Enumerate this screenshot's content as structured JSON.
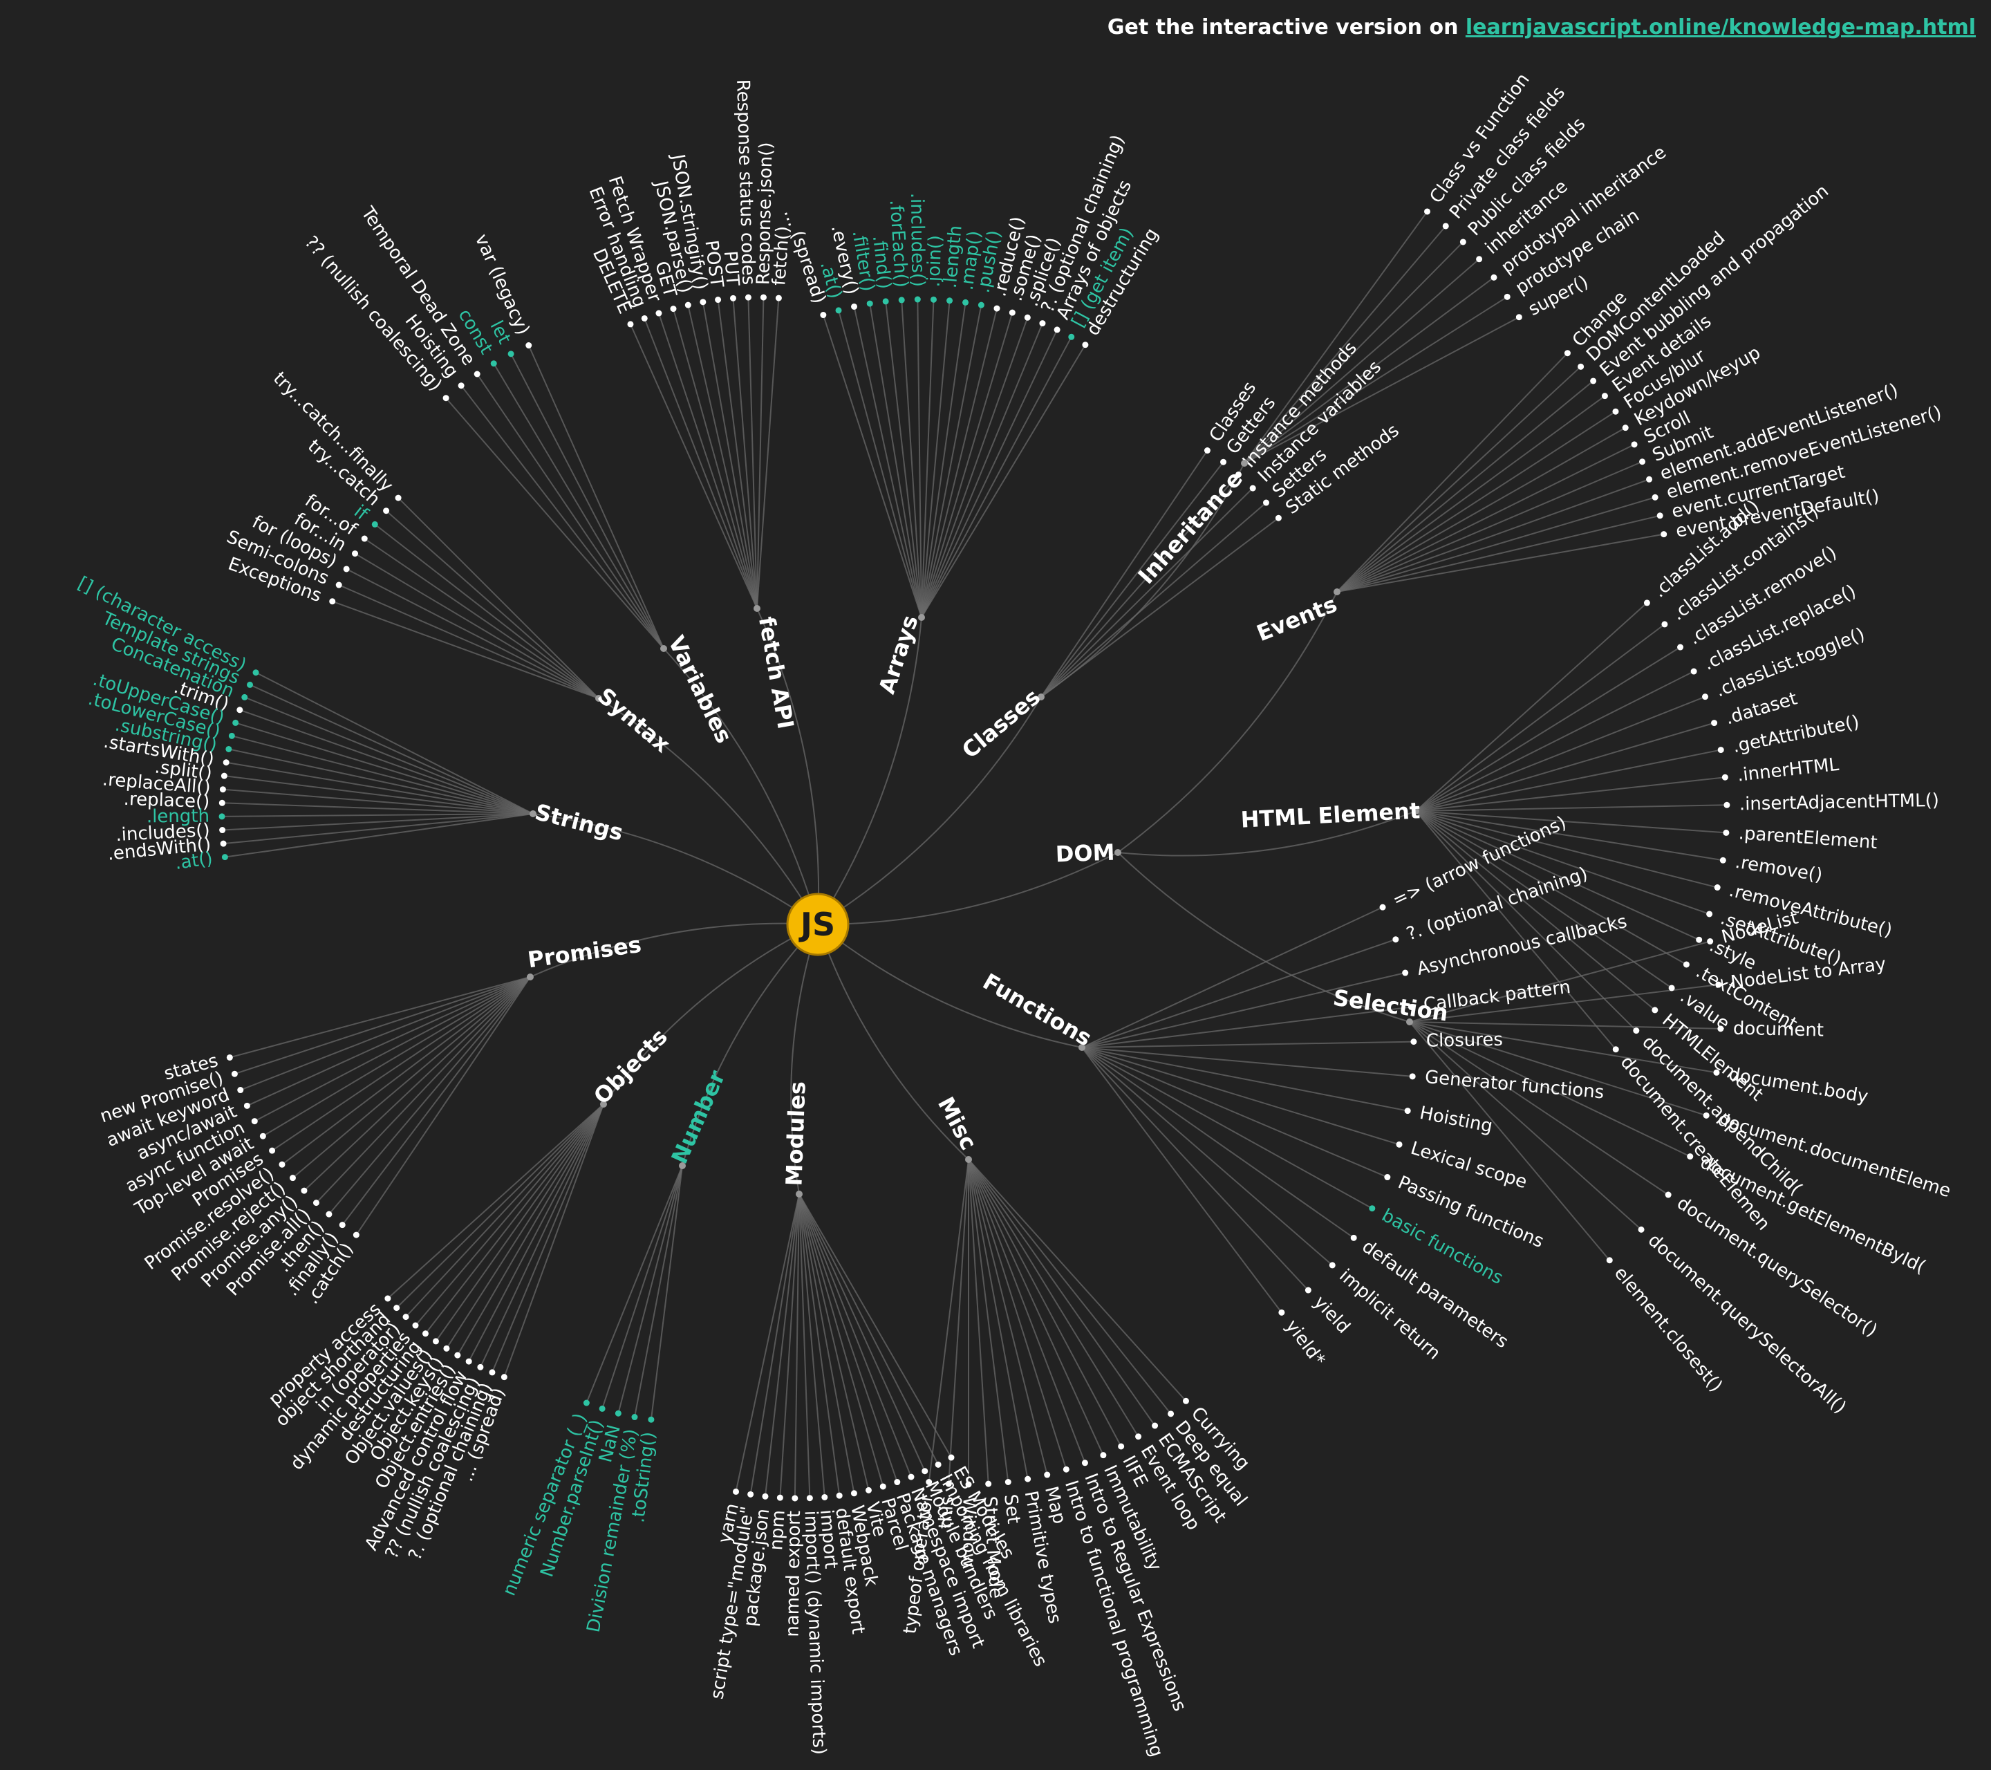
{
  "header": {
    "prefix": "Get the interactive version on ",
    "link_text": "learnjavascript.online/knowledge-map.html"
  },
  "colors": {
    "background": "#222222",
    "text": "#ffffff",
    "accent": "#2ec4a4",
    "root": "#f5b800",
    "edge": "#6a6a6a"
  },
  "root": {
    "label": "JS"
  },
  "groups": [
    {
      "id": "fetch",
      "label": "fetch API",
      "leaves": [
        {
          "t": "fetch()"
        },
        {
          "t": "Response.json()"
        },
        {
          "t": "Response status codes"
        },
        {
          "t": "PUT"
        },
        {
          "t": "POST"
        },
        {
          "t": "JSON.stringify()"
        },
        {
          "t": "JSON.parse()"
        },
        {
          "t": "GET"
        },
        {
          "t": "Fetch Wrapper"
        },
        {
          "t": "Error handling"
        },
        {
          "t": "DELETE"
        }
      ]
    },
    {
      "id": "arrays",
      "label": "Arrays",
      "leaves": [
        {
          "t": "... (spread)"
        },
        {
          "t": ".at()",
          "hl": true
        },
        {
          "t": ".every()"
        },
        {
          "t": ".filter()",
          "hl": true
        },
        {
          "t": ".find()",
          "hl": true
        },
        {
          "t": ".forEach()",
          "hl": true
        },
        {
          "t": ".includes()",
          "hl": true
        },
        {
          "t": ".join()",
          "hl": true
        },
        {
          "t": ".length",
          "hl": true
        },
        {
          "t": ".map()",
          "hl": true
        },
        {
          "t": ".push()",
          "hl": true
        },
        {
          "t": ".reduce()"
        },
        {
          "t": ".some()"
        },
        {
          "t": ".splice()"
        },
        {
          "t": "?. (optional chaining)"
        },
        {
          "t": "Arrays of objects"
        },
        {
          "t": "[] (get item)",
          "hl": true
        },
        {
          "t": "destructuring"
        }
      ]
    },
    {
      "id": "variables",
      "label": "Variables",
      "leaves": [
        {
          "t": "var (legacy)"
        },
        {
          "t": "let",
          "hl": true
        },
        {
          "t": "const",
          "hl": true
        },
        {
          "t": "Temporal Dead Zone"
        },
        {
          "t": "Hoisting"
        },
        {
          "t": "?? (nullish coalescing)"
        }
      ]
    },
    {
      "id": "syntax",
      "label": "Syntax",
      "leaves": [
        {
          "t": "try...catch...finally"
        },
        {
          "t": "try...catch"
        },
        {
          "t": "if",
          "hl": true
        },
        {
          "t": "for...of"
        },
        {
          "t": "for...in"
        },
        {
          "t": "for (loops)"
        },
        {
          "t": "Semi-colons"
        },
        {
          "t": "Exceptions"
        }
      ]
    },
    {
      "id": "strings",
      "label": "Strings",
      "leaves": [
        {
          "t": "[] (character access)",
          "hl": true
        },
        {
          "t": "Template strings",
          "hl": true
        },
        {
          "t": "Concatenation",
          "hl": true
        },
        {
          "t": ".trim()"
        },
        {
          "t": ".toUpperCase()",
          "hl": true
        },
        {
          "t": ".toLowerCase()",
          "hl": true
        },
        {
          "t": ".substring()",
          "hl": true
        },
        {
          "t": ".startsWith()"
        },
        {
          "t": ".split()"
        },
        {
          "t": ".replaceAll()"
        },
        {
          "t": ".replace()"
        },
        {
          "t": ".length",
          "hl": true
        },
        {
          "t": ".includes()"
        },
        {
          "t": ".endsWith()"
        },
        {
          "t": ".at()",
          "hl": true
        }
      ]
    },
    {
      "id": "promises",
      "label": "Promises",
      "leaves": [
        {
          "t": "states"
        },
        {
          "t": "new Promise()"
        },
        {
          "t": "await keyword"
        },
        {
          "t": "async/await"
        },
        {
          "t": "async function"
        },
        {
          "t": "Top-level await"
        },
        {
          "t": "Promises"
        },
        {
          "t": "Promise.resolve()"
        },
        {
          "t": "Promise.reject()"
        },
        {
          "t": "Promise.any()"
        },
        {
          "t": "Promise.all()"
        },
        {
          "t": ".then()"
        },
        {
          "t": ".finally()"
        },
        {
          "t": ".catch()"
        }
      ]
    },
    {
      "id": "objects",
      "label": "Objects",
      "leaves": [
        {
          "t": "property access"
        },
        {
          "t": "object shorthand"
        },
        {
          "t": "in (operator)"
        },
        {
          "t": "dynamic properties"
        },
        {
          "t": "destructuring"
        },
        {
          "t": "Object.values()"
        },
        {
          "t": "Object.keys()"
        },
        {
          "t": "Object.entries()"
        },
        {
          "t": "Advanced control flow"
        },
        {
          "t": "?? (nullish coalescing)"
        },
        {
          "t": "?. (optional chaining)"
        },
        {
          "t": "... (spread)"
        }
      ]
    },
    {
      "id": "number",
      "label": "Number",
      "hl": true,
      "leaves": [
        {
          "t": "numeric separator (_)",
          "hl": true
        },
        {
          "t": "Number.parseInt()",
          "hl": true
        },
        {
          "t": "NaN",
          "hl": true
        },
        {
          "t": "Division remainder (%)",
          "hl": true
        },
        {
          "t": ".toString()",
          "hl": true
        }
      ]
    },
    {
      "id": "modules",
      "label": "Modules",
      "leaves": [
        {
          "t": "yarn"
        },
        {
          "t": "script type=\"module\""
        },
        {
          "t": "package.json"
        },
        {
          "t": "npm"
        },
        {
          "t": "named export"
        },
        {
          "t": "import() (dynamic imports)"
        },
        {
          "t": "import"
        },
        {
          "t": "default export"
        },
        {
          "t": "Webpack"
        },
        {
          "t": "Vite"
        },
        {
          "t": "Parcel"
        },
        {
          "t": "Package managers"
        },
        {
          "t": "Namespace import"
        },
        {
          "t": "Module bundlers"
        },
        {
          "t": "Importing from libraries"
        },
        {
          "t": "ES Modules"
        }
      ]
    },
    {
      "id": "misc",
      "label": "Misc",
      "leaves": [
        {
          "t": "typeof operator"
        },
        {
          "t": "this"
        },
        {
          "t": "Window"
        },
        {
          "t": "Strict Mode"
        },
        {
          "t": "Set"
        },
        {
          "t": "Primitive types"
        },
        {
          "t": "Map"
        },
        {
          "t": "Intro to functional programming"
        },
        {
          "t": "Intro to Regular Expressions"
        },
        {
          "t": "Immutability"
        },
        {
          "t": "IIFE"
        },
        {
          "t": "Event loop"
        },
        {
          "t": "ECMAScript"
        },
        {
          "t": "Deep equal"
        },
        {
          "t": "Currying"
        }
      ]
    },
    {
      "id": "functions",
      "label": "Functions",
      "leaves": [
        {
          "t": "=> (arrow functions)"
        },
        {
          "t": "?. (optional chaining)"
        },
        {
          "t": "Asynchronous callbacks"
        },
        {
          "t": "Callback pattern"
        },
        {
          "t": "Closures"
        },
        {
          "t": "Generator functions"
        },
        {
          "t": "Hoisting"
        },
        {
          "t": "Lexical scope"
        },
        {
          "t": "Passing functions"
        },
        {
          "t": "basic functions",
          "hl": true
        },
        {
          "t": "default parameters"
        },
        {
          "t": "implicit return"
        },
        {
          "t": "yield"
        },
        {
          "t": "yield*"
        }
      ]
    },
    {
      "id": "inheritance",
      "label": "Inheritance",
      "leaves": [
        {
          "t": "Class vs Function"
        },
        {
          "t": "Private class fields"
        },
        {
          "t": "Public class fields"
        },
        {
          "t": "inheritance"
        },
        {
          "t": "prototypal inheritance"
        },
        {
          "t": "prototype chain"
        },
        {
          "t": "super()"
        }
      ]
    },
    {
      "id": "classes",
      "label": "Classes",
      "leaves": [
        {
          "t": "Classes"
        },
        {
          "t": "Getters"
        },
        {
          "t": "Instance methods"
        },
        {
          "t": "Instance variables"
        },
        {
          "t": "Setters"
        },
        {
          "t": "Static methods"
        }
      ]
    },
    {
      "id": "events",
      "label": "Events",
      "leaves": [
        {
          "t": "Change"
        },
        {
          "t": "DOMContentLoaded"
        },
        {
          "t": "Event bubbling and propagation"
        },
        {
          "t": "Event details"
        },
        {
          "t": "Focus/blur"
        },
        {
          "t": "Keydown/keyup"
        },
        {
          "t": "Scroll"
        },
        {
          "t": "Submit"
        },
        {
          "t": "element.addEventListener()"
        },
        {
          "t": "element.removeEventListener()"
        },
        {
          "t": "event.currentTarget"
        },
        {
          "t": "event.preventDefault()"
        }
      ]
    },
    {
      "id": "dom",
      "label": "DOM",
      "leaves": []
    },
    {
      "id": "htmlelement",
      "label": "HTML Element",
      "leaves": [
        {
          "t": ".classList.add()"
        },
        {
          "t": ".classList.contains()"
        },
        {
          "t": ".classList.remove()"
        },
        {
          "t": ".classList.replace()"
        },
        {
          "t": ".classList.toggle()"
        },
        {
          "t": ".dataset"
        },
        {
          "t": ".getAttribute()"
        },
        {
          "t": ".innerHTML"
        },
        {
          "t": ".insertAdjacentHTML()"
        },
        {
          "t": ".parentElement"
        },
        {
          "t": ".remove()"
        },
        {
          "t": ".removeAttribute()"
        },
        {
          "t": ".setAttribute()"
        },
        {
          "t": ".style"
        },
        {
          "t": ".textContent"
        },
        {
          "t": ".value"
        },
        {
          "t": "HTMLElement"
        },
        {
          "t": "document.appendChild("
        },
        {
          "t": "document.createElemen"
        }
      ]
    },
    {
      "id": "selection",
      "label": "Selection",
      "leaves": [
        {
          "t": "NodeList"
        },
        {
          "t": "NodeList to Array"
        },
        {
          "t": "document"
        },
        {
          "t": "document.body"
        },
        {
          "t": "document.documentEleme"
        },
        {
          "t": "document.getElementById("
        },
        {
          "t": "document.querySelector()"
        },
        {
          "t": "document.querySelectorAll()"
        },
        {
          "t": "element.closest()"
        }
      ]
    }
  ]
}
